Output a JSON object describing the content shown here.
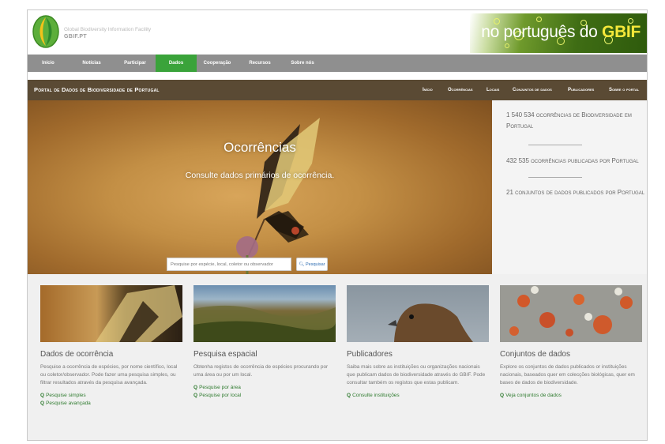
{
  "header": {
    "org_name": "Global Biodiversity Information Facility",
    "org_short": "GBIF.PT",
    "banner_prefix": "no português do ",
    "banner_brand": "GBIF"
  },
  "nav": {
    "items": [
      "Início",
      "Notícias",
      "Participar",
      "Dados",
      "Cooperação",
      "Recursos",
      "Sobre nós"
    ],
    "active": "Dados"
  },
  "portal": {
    "title": "Portal de Dados de Biodiversidade de Portugal",
    "links": [
      "Início",
      "Ocorrências",
      "Locais",
      "Conjuntos de dados",
      "Publicadores",
      "Sobre o portal"
    ]
  },
  "hero": {
    "title": "Ocorrências",
    "subtitle": "Consulte dados primários de ocorrência.",
    "search_placeholder": "Pesquise por espécie, local, coletor ou observador",
    "search_button": "Pesquisar"
  },
  "stats": {
    "occurrences": "1 540 534 ocorrências de Biodiversidade em Portugal",
    "published": "432 535 ocorrências publicadas por Portugal",
    "datasets": "21 conjuntos de dados publicados por Portugal"
  },
  "cards": [
    {
      "title": "Dados de ocorrência",
      "text": "Pesquise a ocorrência de espécies, por nome científico, local ou coletor/observador. Pode fazer uma pesquisa simples, ou filtrar resultados através da pesquisa avançada.",
      "links": [
        "Pesquise simples",
        "Pesquise avançada"
      ]
    },
    {
      "title": "Pesquisa espacial",
      "text": "Obtenha registos de ocorrência de espécies procurando por uma área ou por um local.",
      "links": [
        "Pesquise por área",
        "Pesquise por local"
      ]
    },
    {
      "title": "Publicadores",
      "text": "Saiba mais sobre as instituições ou organizações nacionais que publicam dados de biodiversidade através do GBIF. Pode consultar também os registos que estas publicam.",
      "links": [
        "Consulte instituições"
      ]
    },
    {
      "title": "Conjuntos de dados",
      "text": "Explore os conjuntos de dados publicados or instituições nacionais, baseados quer em colecções biológicas, quer em bases de dados de biodiversidade.",
      "links": [
        "Veja conjuntos de dados"
      ]
    }
  ],
  "colors": {
    "accent": "#3aa33a",
    "link": "#2f7b2f",
    "nav": "#8f8f8f",
    "portal_bar": "#5a4a34"
  }
}
